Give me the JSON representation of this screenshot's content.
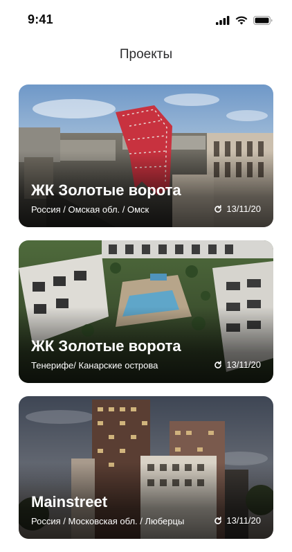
{
  "status_bar": {
    "time": "9:41",
    "icons": [
      "cellular-signal-icon",
      "wifi-icon",
      "battery-icon"
    ]
  },
  "header": {
    "title": "Проекты"
  },
  "projects": [
    {
      "title": "ЖК Золотые ворота",
      "location": "Россия / Омская обл. / Омск",
      "date": "13/11/20",
      "date_icon": "refresh-icon"
    },
    {
      "title": "ЖК Золотые ворота",
      "location": "Тенерифе/ Канарские острова",
      "date": "13/11/20",
      "date_icon": "refresh-icon"
    },
    {
      "title": "Mainstreet",
      "location": "Россия / Московская обл. / Люберцы",
      "date": "13/11/20",
      "date_icon": "refresh-icon"
    }
  ]
}
